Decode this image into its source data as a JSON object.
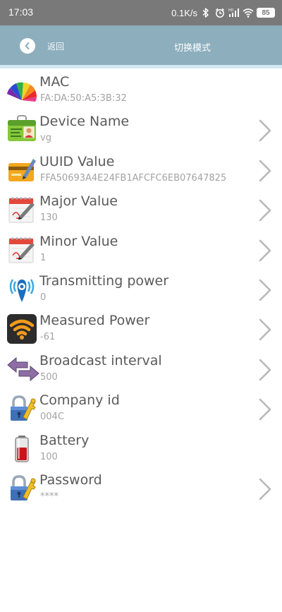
{
  "status_bar": {
    "time": "17:03",
    "net_speed": "0.1K/s",
    "battery": "85",
    "icons": [
      "bluetooth-icon",
      "alarm-icon",
      "signal-hd-icon",
      "wifi-icon",
      "battery-icon"
    ]
  },
  "header": {
    "back_label": "返回",
    "title": "切换模式",
    "color": "#8daebd",
    "strip_color": "#d3e8f3"
  },
  "items": [
    {
      "label": "MAC",
      "value": "FA:DA:50:A5:3B:32",
      "icon": "color-palette-icon",
      "has_chevron": false
    },
    {
      "label": "Device Name",
      "value": "vg",
      "icon": "id-card-icon",
      "has_chevron": true
    },
    {
      "label": "UUID Value",
      "value": "FFA50693A4E24FB1AFCFC6EB07647825",
      "icon": "card-pen-icon",
      "has_chevron": true
    },
    {
      "label": "Major Value",
      "value": "130",
      "icon": "calendar-pen-icon",
      "has_chevron": true
    },
    {
      "label": "Minor Value",
      "value": "1",
      "icon": "calendar-pen-icon",
      "has_chevron": true
    },
    {
      "label": "Transmitting power",
      "value": "0",
      "icon": "beacon-signal-icon",
      "has_chevron": true
    },
    {
      "label": "Measured Power",
      "value": "-61",
      "icon": "wifi-signal-icon",
      "has_chevron": true
    },
    {
      "label": "Broadcast interval",
      "value": "500",
      "icon": "double-arrow-icon",
      "has_chevron": true
    },
    {
      "label": "Company id",
      "value": "004C",
      "icon": "lock-key-icon",
      "has_chevron": true
    },
    {
      "label": "Battery",
      "value": "100",
      "icon": "battery-icon",
      "has_chevron": false
    },
    {
      "label": "Password",
      "value": "****",
      "icon": "lock-key-icon",
      "has_chevron": true
    }
  ]
}
